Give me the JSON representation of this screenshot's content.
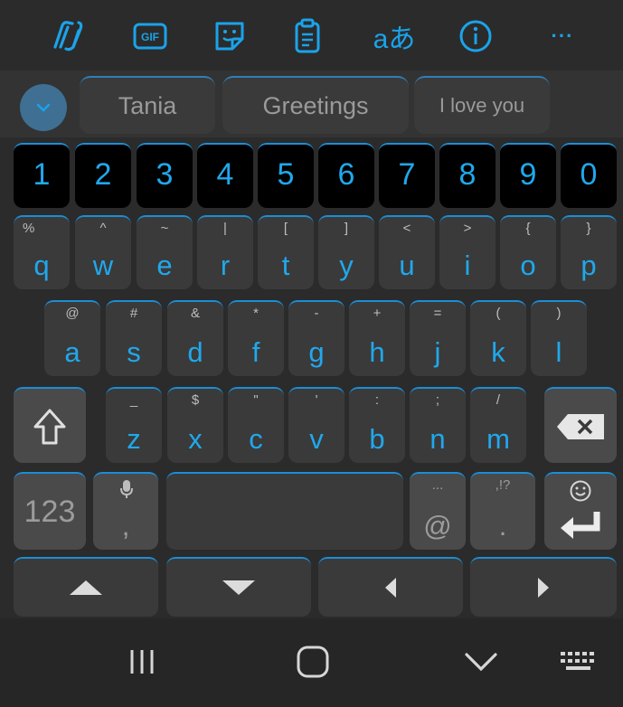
{
  "toolbar": {
    "items": [
      {
        "icon": "copilot-icon"
      },
      {
        "icon": "gif-icon",
        "label": "GIF"
      },
      {
        "icon": "sticker-icon"
      },
      {
        "icon": "clipboard-icon"
      },
      {
        "icon": "translate-icon",
        "label": "aあ"
      },
      {
        "icon": "info-icon"
      },
      {
        "icon": "more-icon",
        "label": "···"
      }
    ]
  },
  "suggestions": {
    "items": [
      "Tania",
      "Greetings",
      "I love you"
    ]
  },
  "keyboard": {
    "numbers": [
      "1",
      "2",
      "3",
      "4",
      "5",
      "6",
      "7",
      "8",
      "9",
      "0"
    ],
    "row_q": [
      {
        "main": "q",
        "sub": "%"
      },
      {
        "main": "w",
        "sub": "^"
      },
      {
        "main": "e",
        "sub": "~"
      },
      {
        "main": "r",
        "sub": "|"
      },
      {
        "main": "t",
        "sub": "["
      },
      {
        "main": "y",
        "sub": "]"
      },
      {
        "main": "u",
        "sub": "<"
      },
      {
        "main": "i",
        "sub": ">"
      },
      {
        "main": "o",
        "sub": "{"
      },
      {
        "main": "p",
        "sub": "}"
      }
    ],
    "row_a": [
      {
        "main": "a",
        "sub": "@"
      },
      {
        "main": "s",
        "sub": "#"
      },
      {
        "main": "d",
        "sub": "&"
      },
      {
        "main": "f",
        "sub": "*"
      },
      {
        "main": "g",
        "sub": "-"
      },
      {
        "main": "h",
        "sub": "+"
      },
      {
        "main": "j",
        "sub": "="
      },
      {
        "main": "k",
        "sub": "("
      },
      {
        "main": "l",
        "sub": ")"
      }
    ],
    "row_z": [
      {
        "main": "z",
        "sub": "_"
      },
      {
        "main": "x",
        "sub": "$"
      },
      {
        "main": "c",
        "sub": "\""
      },
      {
        "main": "v",
        "sub": "'"
      },
      {
        "main": "b",
        "sub": ":"
      },
      {
        "main": "n",
        "sub": ";"
      },
      {
        "main": "m",
        "sub": "/"
      }
    ],
    "symbols_label": "123",
    "comma": {
      "main": ",",
      "icon": "microphone-icon"
    },
    "at": {
      "main": "@",
      "sub": "..."
    },
    "period": {
      "main": ".",
      "sub": ",!?"
    },
    "enter": {
      "icon": "enter-icon",
      "sub_icon": "emoji-icon"
    }
  },
  "colors": {
    "accent": "#1ba6ea",
    "key_bg": "#3a3a3a",
    "number_bg": "#000000",
    "bar_bg": "#262626"
  }
}
